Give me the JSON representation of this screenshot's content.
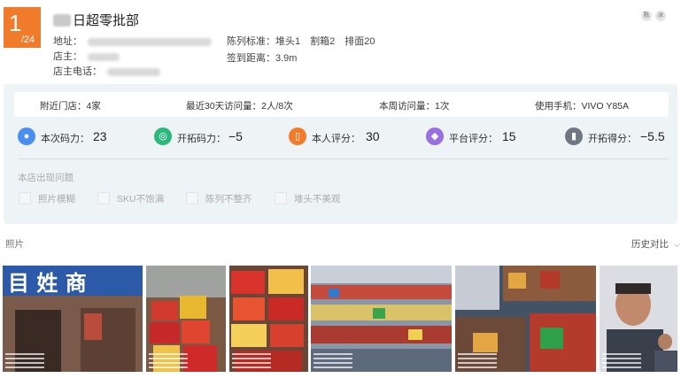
{
  "header": {
    "rank_current": "1",
    "rank_total": "/24",
    "store_name": "日超零批部",
    "address_label": "地址：",
    "owner_label": "店主：",
    "phone_label": "店主电话：",
    "display_standard": "陈列标准：堆头1　割箱2　排面20",
    "checkin_distance": "签到距离：3.9m",
    "tags": [
      "陈",
      "冰"
    ]
  },
  "stats": {
    "nearby_stores": "附近门店：4家",
    "visits_30d": "最近30天访问量：2人/8次",
    "visits_week": "本周访问量：1次",
    "device": "使用手机：VIVO Y85A"
  },
  "metrics": [
    {
      "icon": "person-icon",
      "label": "本次码力：",
      "value": "23",
      "color": "#4a8ff0"
    },
    {
      "icon": "target-icon",
      "label": "开拓码力：",
      "value": "−5",
      "color": "#2db77c"
    },
    {
      "icon": "card-icon",
      "label": "本人评分：",
      "value": "30",
      "color": "#f07b2a"
    },
    {
      "icon": "user-icon",
      "label": "平台评分：",
      "value": "15",
      "color": "#9a6fe0"
    },
    {
      "icon": "chart-icon",
      "label": "开拓得分：",
      "value": "−5.5",
      "color": "#6f7784"
    }
  ],
  "issues": {
    "title": "本店出现问题",
    "items": [
      "照片模糊",
      "SKU不饱满",
      "陈列不整齐",
      "堆头不美观"
    ]
  },
  "photos": {
    "label": "照片",
    "history_label": "历史对比",
    "items": [
      {
        "name": "photo-storefront",
        "palette": [
          "#2d5aa8",
          "#6d4a3a",
          "#a9a9a9"
        ]
      },
      {
        "name": "photo-boxes-1",
        "palette": [
          "#c7282a",
          "#e7b830",
          "#7a4a2a"
        ]
      },
      {
        "name": "photo-boxes-2",
        "palette": [
          "#d9342b",
          "#f2c04a",
          "#8b2a1e"
        ]
      },
      {
        "name": "photo-shelves",
        "palette": [
          "#7b8ea3",
          "#c44b3b",
          "#d9c26a"
        ]
      },
      {
        "name": "photo-interior",
        "palette": [
          "#b43b2c",
          "#e2a642",
          "#445266"
        ]
      },
      {
        "name": "photo-person",
        "palette": [
          "#dcdde2",
          "#c18a6c",
          "#2f3340"
        ]
      }
    ]
  }
}
